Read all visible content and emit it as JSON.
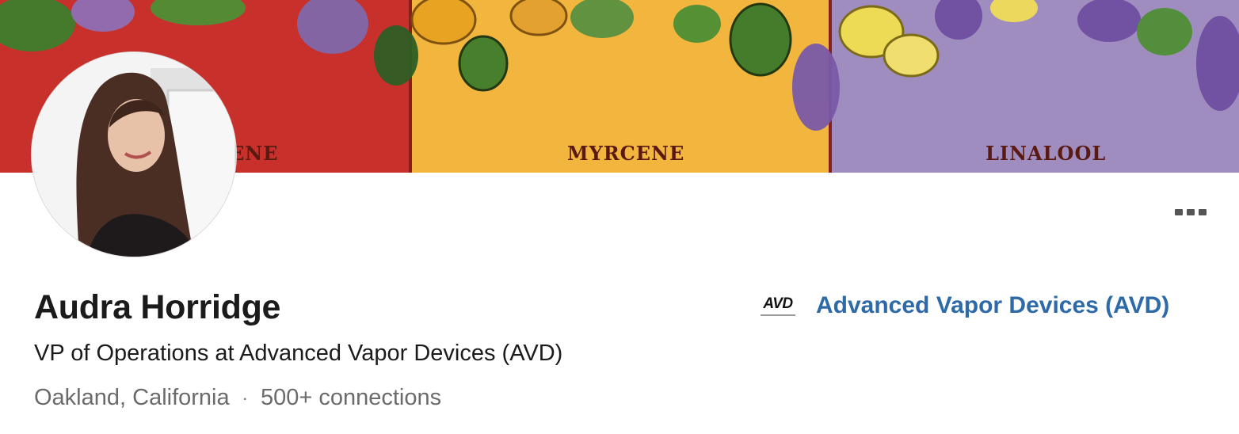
{
  "banner": {
    "panels": [
      {
        "label": "ENE",
        "color": "#c8302b"
      },
      {
        "label": "MYRCENE",
        "color": "#f2b53e"
      },
      {
        "label": "LINALOOL",
        "color": "#a08dc0"
      }
    ]
  },
  "profile": {
    "name": "Audra Horridge",
    "headline": "VP of Operations at Advanced Vapor Devices (AVD)",
    "location": "Oakland, California",
    "separator": "·",
    "connections": "500+ connections"
  },
  "company": {
    "logo_text": "AVD",
    "name": "Advanced Vapor Devices (AVD)"
  },
  "icons": {
    "more": "more-horizontal-icon"
  }
}
